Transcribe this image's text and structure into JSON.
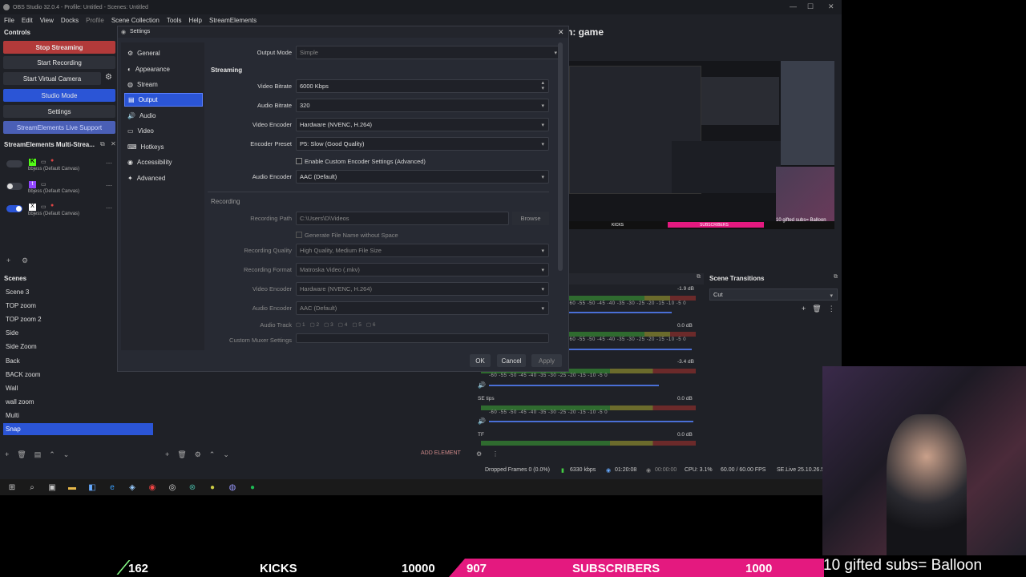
{
  "window": {
    "title": "OBS Studio 32.0.4 - Profile: Untitled - Scenes: Untitled"
  },
  "menu": [
    "File",
    "Edit",
    "View",
    "Docks",
    "Profile",
    "Scene Collection",
    "Tools",
    "Help",
    "StreamElements"
  ],
  "controls": {
    "title": "Controls",
    "stop_streaming": "Stop Streaming",
    "start_recording": "Start Recording",
    "start_virtual_camera": "Start Virtual Camera",
    "studio_mode": "Studio Mode",
    "settings": "Settings",
    "se_live_support": "StreamElements Live Support"
  },
  "multistream": {
    "title": "StreamElements Multi-Strea...",
    "rows": [
      {
        "name": "bbjess (Default Canvas)"
      },
      {
        "name": "bbjess (Default Canvas)"
      },
      {
        "name": "bbjess (Default Canvas)"
      }
    ]
  },
  "scenes": {
    "title": "Scenes",
    "items": [
      "Scene 3",
      "TOP zoom",
      "TOP zoom 2",
      "Side",
      "Side Zoom",
      "Back",
      "BACK zoom",
      "Wall",
      "wall zoom",
      "Multi",
      "Snap"
    ],
    "selected": "Snap"
  },
  "preview_title": "n: game",
  "settings": {
    "title": "Settings",
    "nav": [
      "General",
      "Appearance",
      "Stream",
      "Output",
      "Audio",
      "Video",
      "Hotkeys",
      "Accessibility",
      "Advanced"
    ],
    "selected_nav": "Output",
    "output_mode_label": "Output Mode",
    "output_mode_value": "Simple",
    "streaming_header": "Streaming",
    "video_bitrate_label": "Video Bitrate",
    "video_bitrate_value": "6000 Kbps",
    "audio_bitrate_label": "Audio Bitrate",
    "audio_bitrate_value": "320",
    "video_encoder_label": "Video Encoder",
    "video_encoder_value": "Hardware (NVENC, H.264)",
    "encoder_preset_label": "Encoder Preset",
    "encoder_preset_value": "P5: Slow (Good Quality)",
    "custom_encoder_label": "Enable Custom Encoder Settings (Advanced)",
    "audio_encoder_label": "Audio Encoder",
    "audio_encoder_value": "AAC (Default)",
    "recording_header": "Recording",
    "recording_path_label": "Recording Path",
    "recording_path_value": "C:\\Users\\D\\Videos",
    "browse": "Browse",
    "gen_filename_label": "Generate File Name without Space",
    "rec_quality_label": "Recording Quality",
    "rec_quality_value": "High Quality, Medium File Size",
    "rec_format_label": "Recording Format",
    "rec_format_value": "Matroska Video (.mkv)",
    "rec_video_encoder_label": "Video Encoder",
    "rec_video_encoder_value": "Hardware (NVENC, H.264)",
    "rec_audio_encoder_label": "Audio Encoder",
    "rec_audio_encoder_value": "AAC (Default)",
    "audio_track_label": "Audio Track",
    "audio_tracks": [
      "1",
      "2",
      "3",
      "4",
      "5",
      "6"
    ],
    "custom_muxer_label": "Custom Muxer Settings",
    "ok": "OK",
    "cancel": "Cancel",
    "apply": "Apply"
  },
  "transitions": {
    "title": "Scene Transitions",
    "value": "Cut"
  },
  "mixer": {
    "channels": [
      {
        "name": "",
        "db": "-1.9 dB"
      },
      {
        "name": "",
        "db": "0.0 dB"
      },
      {
        "name": "",
        "db": "-3.4 dB"
      },
      {
        "name": "SE tips",
        "db": "0.0 dB"
      },
      {
        "name": "TF",
        "db": "0.0 dB"
      }
    ],
    "ticks": "-60  -55  -50  -45  -40  -35  -30  -25  -20  -15  -10  -5  0"
  },
  "sources_bar": {
    "add_element": "ADD ELEMENT"
  },
  "status": {
    "dropped": "Dropped Frames 0 (0.0%)",
    "kbps": "6330 kbps",
    "stream_time": "01:20:08",
    "rec_time": "00:00:00",
    "cpu": "CPU: 3.1%",
    "fps": "60.00 / 60.00 FPS",
    "se": "SE.Live 25.10.26.5"
  },
  "ticker": {
    "v1": "162",
    "kicks": "KICKS",
    "v2": "10000",
    "v3": "907",
    "subs": "SUBSCRIBERS",
    "v4": "1000",
    "gifted": "10 gifted subs= Balloon"
  },
  "preview_overlay": {
    "gifted_small": "10 gifted subs= Balloon",
    "kicks_small": "KICKS",
    "subs_small": "SUBSCRIBERS"
  },
  "colors": {
    "accent": "#2b55d6",
    "stop": "#b23a3a",
    "pink": "#e4197f"
  }
}
